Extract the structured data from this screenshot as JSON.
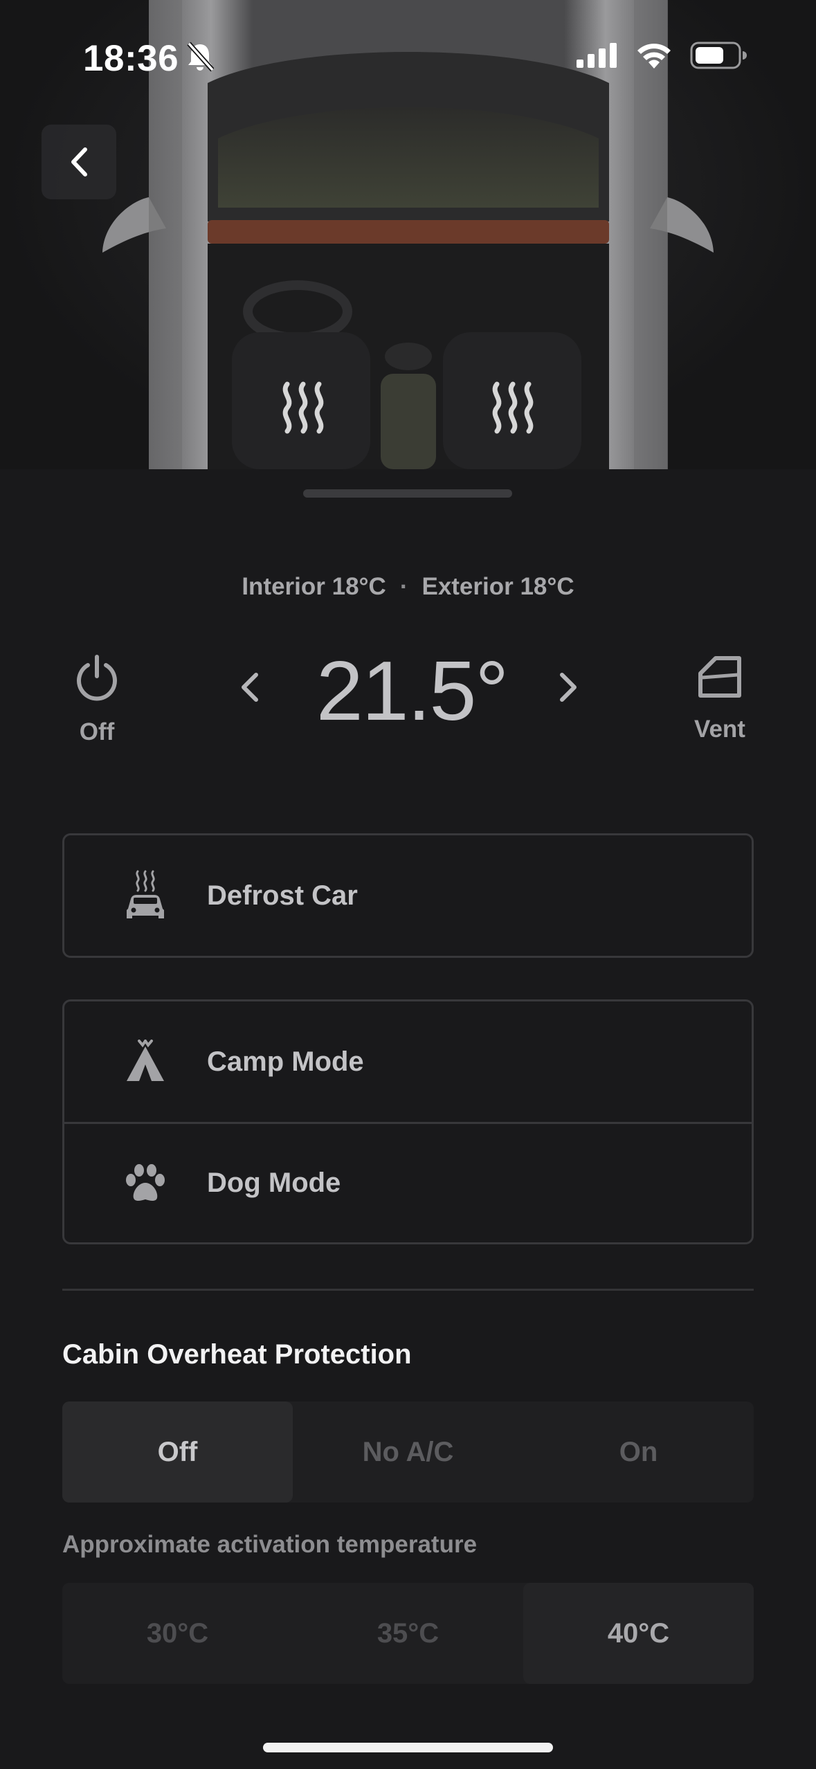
{
  "status_bar": {
    "time": "18:36",
    "icons": [
      "bell-slash-icon",
      "signal-icon",
      "wifi-icon",
      "battery-icon"
    ]
  },
  "climate": {
    "interior": "Interior 18°C",
    "separator": "·",
    "exterior": "Exterior 18°C",
    "temperature": "21.5°",
    "power_label": "Off",
    "vent_label": "Vent"
  },
  "options": {
    "defrost": "Defrost Car",
    "camp": "Camp Mode",
    "dog": "Dog Mode"
  },
  "overheat": {
    "title": "Cabin Overheat Protection",
    "modes": [
      "Off",
      "No A/C",
      "On"
    ],
    "selected_mode": "Off",
    "activation_label": "Approximate activation temperature",
    "temps": [
      "30°C",
      "35°C",
      "40°C"
    ],
    "selected_temp": "40°C"
  },
  "colors": {
    "background": "#19191b",
    "card_border": "#38383b",
    "text_primary": "#c3c3c6",
    "accent_seat": "#d7d7d7"
  }
}
